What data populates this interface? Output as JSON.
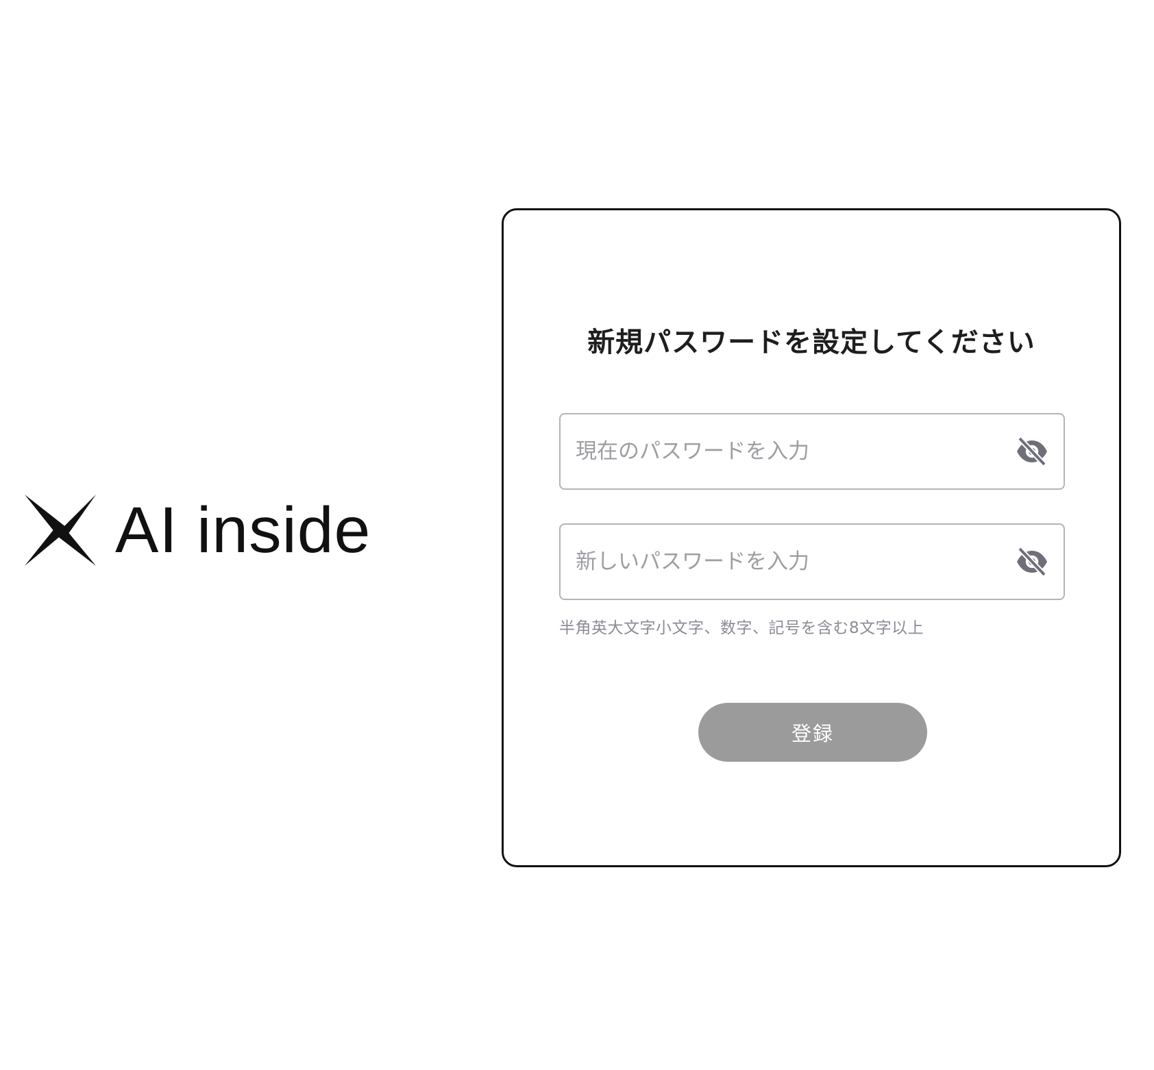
{
  "brand": {
    "name": "AI inside",
    "logo_icon": "ai-inside-x-mark-icon"
  },
  "form": {
    "title": "新規パスワードを設定してください",
    "current_password": {
      "placeholder": "現在のパスワードを入力",
      "value": "",
      "toggle_icon": "eye-slash-icon"
    },
    "new_password": {
      "placeholder": "新しいパスワードを入力",
      "value": "",
      "toggle_icon": "eye-slash-icon"
    },
    "hint": "半角英大文字小文字、数字、記号を含む8文字以上",
    "submit_label": "登録"
  },
  "colors": {
    "text_dark": "#1e1e1e",
    "border_card": "#111111",
    "border_field": "#b4b4b8",
    "placeholder": "#9d9da3",
    "hint": "#8b8b98",
    "button_disabled_bg": "#9b9b9b",
    "icon": "#6f6f7a"
  }
}
